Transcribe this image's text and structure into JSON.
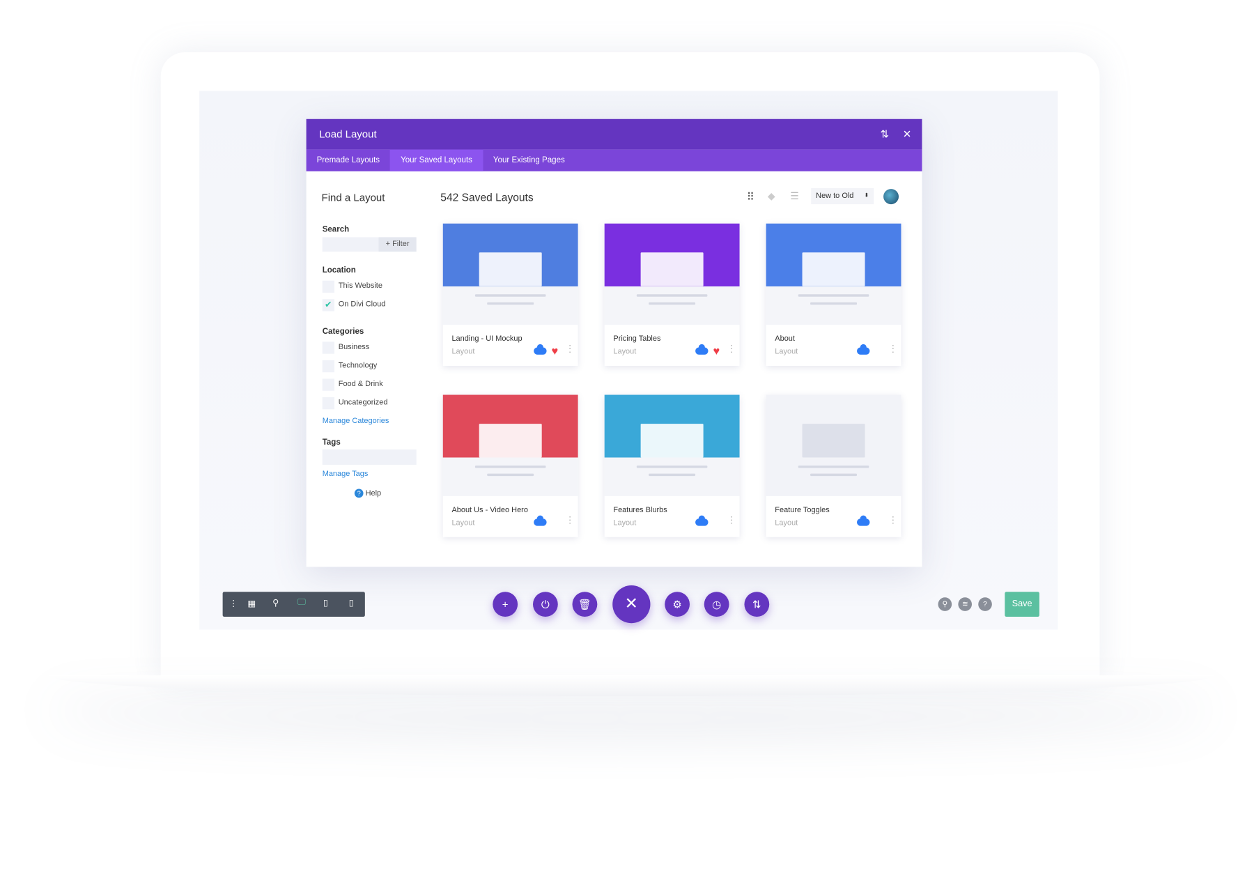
{
  "modal": {
    "title": "Load Layout",
    "tabs": [
      {
        "label": "Premade Layouts"
      },
      {
        "label": "Your Saved Layouts",
        "active": true
      },
      {
        "label": "Your Existing Pages"
      }
    ]
  },
  "sidebar": {
    "title": "Find a Layout",
    "search_label": "Search",
    "search_value": "",
    "filter_label": "+ Filter",
    "location_label": "Location",
    "locations": [
      {
        "label": "This Website",
        "checked": false
      },
      {
        "label": "On Divi Cloud",
        "checked": true
      }
    ],
    "categories_label": "Categories",
    "categories": [
      {
        "label": "Business"
      },
      {
        "label": "Technology"
      },
      {
        "label": "Food & Drink"
      },
      {
        "label": "Uncategorized"
      }
    ],
    "manage_categories": "Manage Categories",
    "tags_label": "Tags",
    "manage_tags": "Manage Tags",
    "help": "Help"
  },
  "main": {
    "count_title": "542 Saved Layouts",
    "sort": "New to Old",
    "cards": [
      {
        "title": "Landing - UI Mockup",
        "sub": "Layout",
        "favorite": true,
        "thumb": "#4f7ee0"
      },
      {
        "title": "Pricing Tables",
        "sub": "Layout",
        "favorite": true,
        "thumb": "#7a2fe0"
      },
      {
        "title": "About",
        "sub": "Layout",
        "favorite": false,
        "thumb": "#4b7fe8"
      },
      {
        "title": "About Us - Video Hero",
        "sub": "Layout",
        "favorite": false,
        "thumb": "#e04a5a"
      },
      {
        "title": "Features Blurbs",
        "sub": "Layout",
        "favorite": false,
        "thumb": "#3aa8d8"
      },
      {
        "title": "Feature Toggles",
        "sub": "Layout",
        "favorite": false,
        "thumb": "#f2f3f8"
      }
    ]
  },
  "toolbar": {
    "save": "Save"
  },
  "colors": {
    "primary": "#6435c0",
    "tab": "#7b45d9",
    "save": "#5bc0a0",
    "cloud": "#2e7cf6",
    "heart": "#ef3d46"
  }
}
